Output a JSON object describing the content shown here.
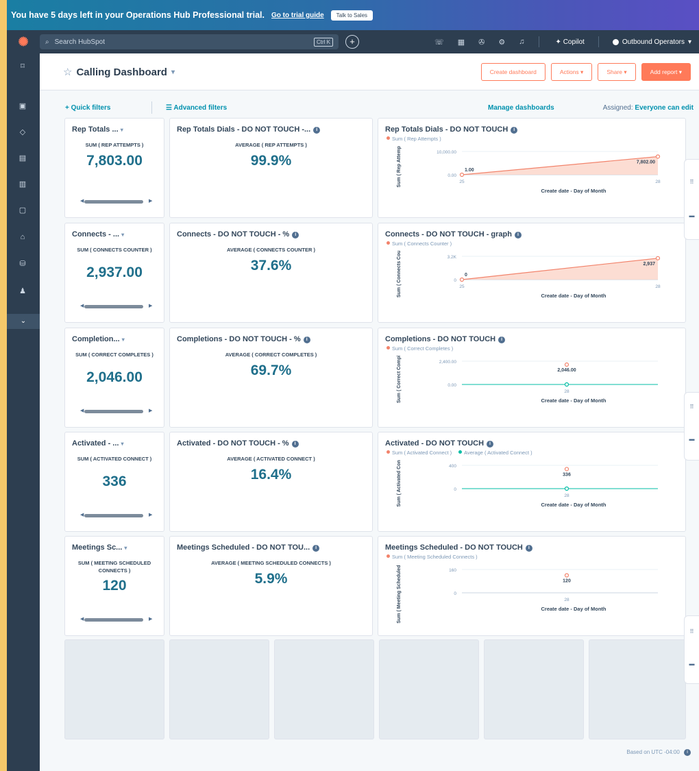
{
  "banner": {
    "text": "You have 5 days left in your Operations Hub Professional trial.",
    "link": "Go to trial guide",
    "button": "Talk to Sales"
  },
  "topnav": {
    "logo": "hubspot-logo",
    "search_placeholder": "Search HubSpot",
    "shortcut": "Ctrl K",
    "copilot": "Copilot",
    "account": "Outbound Operators"
  },
  "header": {
    "title": "Calling Dashboard",
    "buttons": {
      "create": "Create dashboard",
      "actions": "Actions",
      "share": "Share",
      "add_report": "Add report"
    }
  },
  "filters": {
    "quick": "Quick filters",
    "advanced": "Advanced filters",
    "manage": "Manage dashboards",
    "assigned_label": "Assigned:",
    "assigned_value": "Everyone can edit"
  },
  "rows": [
    {
      "small_title": "Rep Totals ...",
      "small_sub": "SUM ( REP ATTEMPTS )",
      "small_value": "7,803.00",
      "pct_title": "Rep Totals Dials - DO NOT TOUCH -...",
      "pct_sub": "AVERAGE ( REP ATTEMPTS )",
      "pct_value": "99.9%",
      "chart_title": "Rep Totals Dials - DO NOT TOUCH",
      "legend": [
        "Sum ( Rep Attempts )"
      ]
    },
    {
      "small_title": "Connects - ...",
      "small_sub": "SUM ( CONNECTS COUNTER )",
      "small_value": "2,937.00",
      "pct_title": "Connects - DO NOT TOUCH - %",
      "pct_sub": "AVERAGE ( CONNECTS COUNTER )",
      "pct_value": "37.6%",
      "chart_title": "Connects - DO NOT TOUCH - graph",
      "legend": [
        "Sum ( Connects Counter )"
      ]
    },
    {
      "small_title": "Completion...",
      "small_sub": "SUM ( CORRECT COMPLETES )",
      "small_value": "2,046.00",
      "pct_title": "Completions - DO NOT TOUCH - %",
      "pct_sub": "AVERAGE ( CORRECT COMPLETES )",
      "pct_value": "69.7%",
      "chart_title": "Completions - DO NOT TOUCH",
      "legend": [
        "Sum ( Correct Completes )"
      ]
    },
    {
      "small_title": "Activated - ...",
      "small_sub": "SUM ( ACTIVATED CONNECT )",
      "small_value": "336",
      "pct_title": "Activated - DO NOT TOUCH - %",
      "pct_sub": "AVERAGE ( ACTIVATED CONNECT )",
      "pct_value": "16.4%",
      "chart_title": "Activated - DO NOT TOUCH",
      "legend": [
        "Sum ( Activated Connect )",
        "Average ( Activated Connect )"
      ]
    },
    {
      "small_title": "Meetings Sc...",
      "small_sub": "SUM ( MEETING SCHEDULED CONNECTS )",
      "small_value": "120",
      "pct_title": "Meetings Scheduled - DO NOT TOU...",
      "pct_sub": "AVERAGE ( MEETING SCHEDULED CONNECTS )",
      "pct_value": "5.9%",
      "chart_title": "Meetings Scheduled - DO NOT TOUCH",
      "legend": [
        "Sum ( Meeting Scheduled Connects )"
      ]
    }
  ],
  "chart_data": [
    {
      "type": "area",
      "title": "Rep Totals Dials - DO NOT TOUCH",
      "xlabel": "Create date - Day of Month",
      "ylabel": "Sum ( Rep Attempts )",
      "ytick_labels": [
        "10,000.00",
        "0.00"
      ],
      "ylim": [
        0,
        10000
      ],
      "x": [
        25,
        28
      ],
      "series": [
        {
          "name": "Sum ( Rep Attempts )",
          "values": [
            1.0,
            7802.0
          ],
          "labels": [
            "1.00",
            "7,802.00"
          ]
        }
      ]
    },
    {
      "type": "area",
      "title": "Connects - DO NOT TOUCH - graph",
      "xlabel": "Create date - Day of Month",
      "ylabel": "Sum ( Connects Counter )",
      "ytick_labels": [
        "3.2K",
        "0"
      ],
      "ylim": [
        0,
        3200
      ],
      "x": [
        25,
        28
      ],
      "series": [
        {
          "name": "Sum ( Connects Counter )",
          "values": [
            0,
            2937
          ],
          "labels": [
            "0",
            "2,937"
          ]
        }
      ]
    },
    {
      "type": "line",
      "title": "Completions - DO NOT TOUCH",
      "xlabel": "Create date - Day of Month",
      "ylabel": "Sum ( Correct Completes )",
      "ytick_labels": [
        "2,400.00",
        "0.00"
      ],
      "ylim": [
        0,
        2400
      ],
      "x": [
        28
      ],
      "series": [
        {
          "name": "Sum ( Correct Completes )",
          "values": [
            2046
          ],
          "labels": [
            "2,046.00"
          ]
        },
        {
          "values": [
            0
          ],
          "labels": [
            ""
          ]
        }
      ]
    },
    {
      "type": "line",
      "title": "Activated - DO NOT TOUCH",
      "xlabel": "Create date - Day of Month",
      "ylabel": "Sum ( Activated Connect )",
      "ytick_labels": [
        "400",
        "0"
      ],
      "ylim": [
        0,
        400
      ],
      "x": [
        28
      ],
      "series": [
        {
          "name": "Sum ( Activated Connect )",
          "values": [
            336
          ],
          "labels": [
            "336"
          ]
        },
        {
          "name": "Average ( Activated Connect )",
          "values": [
            0
          ],
          "labels": [
            ""
          ]
        }
      ]
    },
    {
      "type": "line",
      "title": "Meetings Scheduled - DO NOT TOUCH",
      "xlabel": "Create date - Day of Month",
      "ylabel": "Sum ( Meeting Scheduled Connects )",
      "ytick_labels": [
        "160",
        "0"
      ],
      "ylim": [
        0,
        160
      ],
      "x": [
        28
      ],
      "series": [
        {
          "name": "Sum ( Meeting Scheduled Connects )",
          "values": [
            120
          ],
          "labels": [
            "120"
          ]
        }
      ]
    }
  ],
  "footer": {
    "timezone": "Based on UTC -04:00"
  },
  "colors": {
    "accent": "#ff7a59",
    "teal": "#0091ae",
    "value": "#1f6f8b",
    "series_sum": "#f2836b",
    "series_avg": "#00bda5"
  }
}
